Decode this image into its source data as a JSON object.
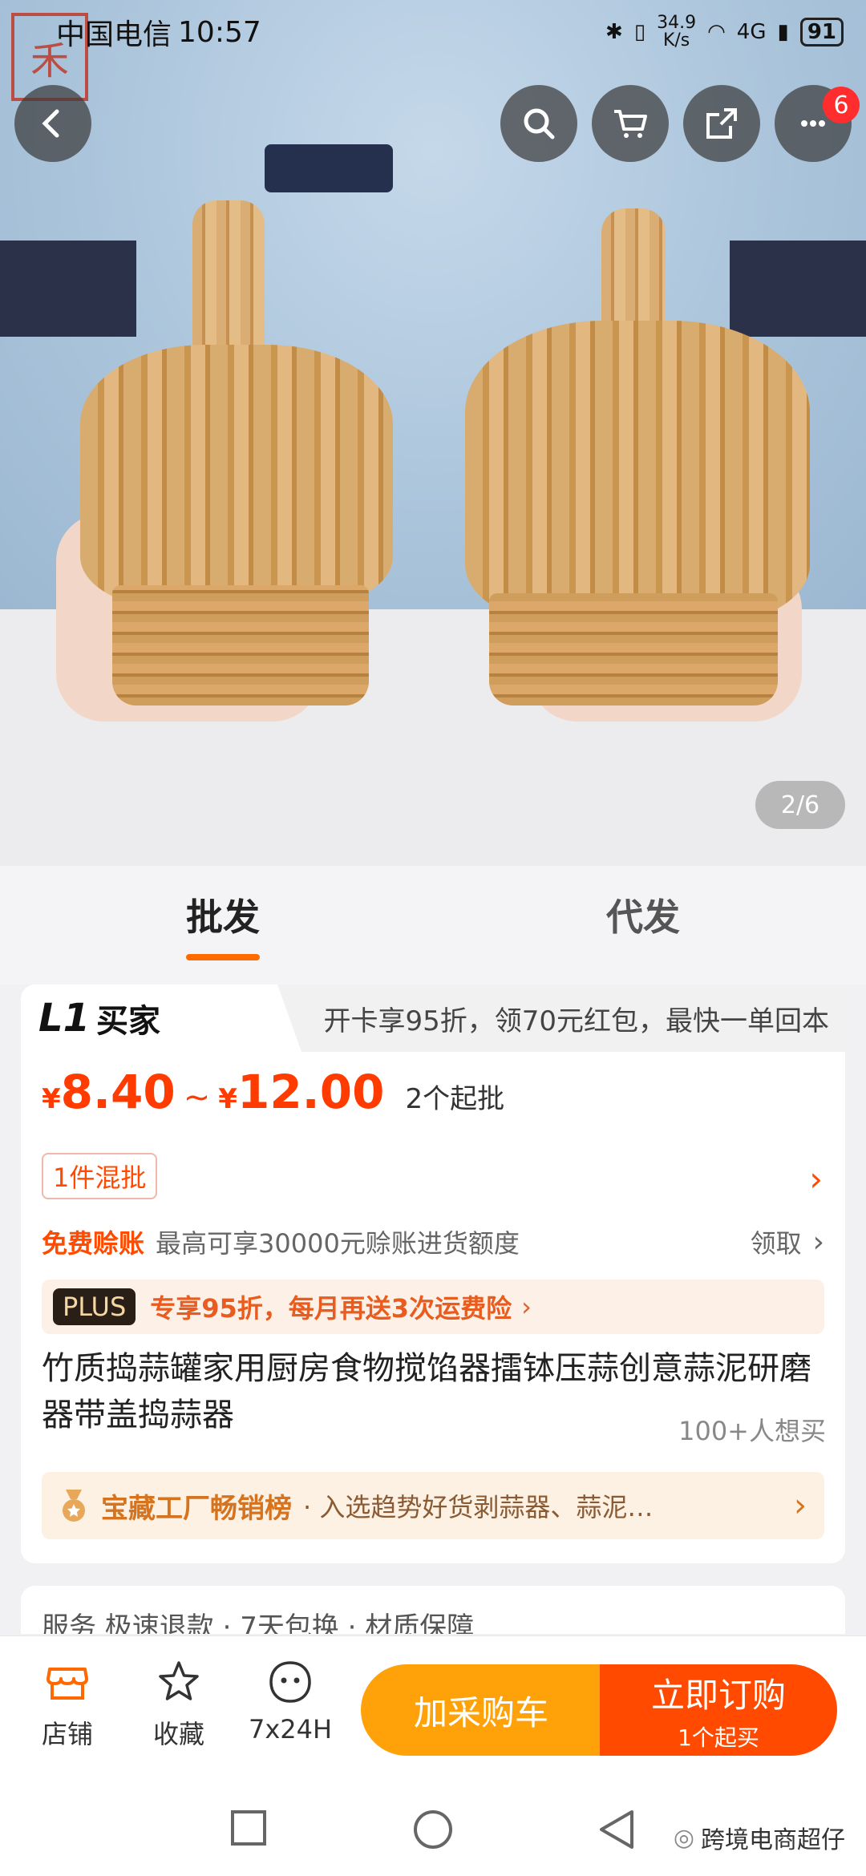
{
  "status_bar": {
    "carrier": "中国电信",
    "time": "10:57",
    "net_speed": "34.9\nK/s",
    "signal_label": "4G",
    "battery": "91"
  },
  "top_nav": {
    "cart_badge": "6"
  },
  "gallery": {
    "pager": "2/6"
  },
  "tabs": {
    "wholesale": "批发",
    "dropship": "代发"
  },
  "membership": {
    "level_mark": "L1",
    "level_label": "买家",
    "promo": "开卡享95折，领70元红包，最快一单回本"
  },
  "price": {
    "currency": "¥",
    "low": "8.40",
    "high": "12.00",
    "separator": "~",
    "min_order": "2个起批"
  },
  "mix_tag": "1件混批",
  "credit": {
    "title": "免费赊账",
    "desc": "最高可享30000元赊账进货额度",
    "action": "领取"
  },
  "plus": {
    "tag": "PLUS",
    "text": "专享95折，每月再送3次运费险"
  },
  "product": {
    "title": "竹质捣蒜罐家用厨房食物搅馅器擂钵压蒜创意蒜泥研磨器带盖捣蒜器",
    "want_count": "100+人想买"
  },
  "ranking": {
    "title": "宝藏工厂畅销榜",
    "text": "· 入选趋势好货剥蒜器、蒜泥…"
  },
  "service": {
    "text": "服务   极速退款 · 7天包换 · 材质保障"
  },
  "action_bar": {
    "shop": "店铺",
    "favorite": "收藏",
    "service": "7x24H",
    "add_cart": "加采购车",
    "buy_now": "立即订购",
    "buy_sub": "1个起买"
  },
  "watermark": "跨境电商超仔",
  "colors": {
    "accent": "#ff4a00",
    "cart": "#ffa20a"
  }
}
